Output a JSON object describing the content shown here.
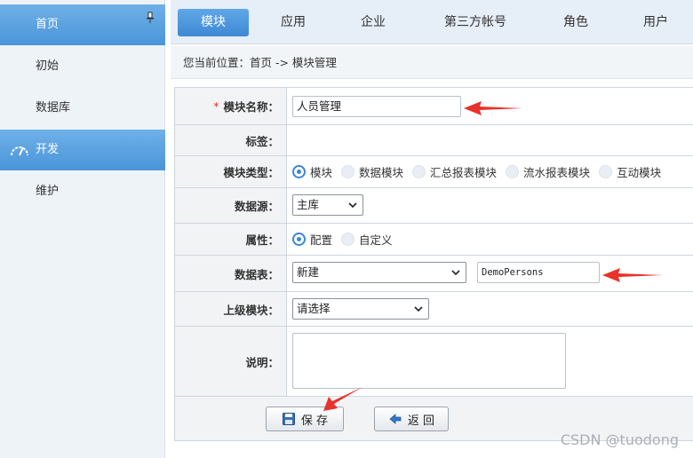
{
  "sidebar": {
    "items": [
      {
        "label": "首页",
        "active": true
      },
      {
        "label": "初始",
        "active": false
      },
      {
        "label": "数据库",
        "active": false
      },
      {
        "label": "开发",
        "active": true,
        "icon": "speedometer-icon"
      },
      {
        "label": "维护",
        "active": false
      }
    ],
    "pin_icon": "pin-icon"
  },
  "tabs": [
    {
      "label": "模块",
      "active": true
    },
    {
      "label": "应用",
      "active": false
    },
    {
      "label": "企业",
      "active": false
    },
    {
      "label": "第三方帐号",
      "active": false
    },
    {
      "label": "角色",
      "active": false
    },
    {
      "label": "用户",
      "active": false
    }
  ],
  "breadcrumb": "您当前位置：首页 -> 模块管理",
  "form": {
    "required_mark": "*",
    "module_name": {
      "label": "模块名称：",
      "value": "人员管理"
    },
    "tags": {
      "label": "标签："
    },
    "module_type": {
      "label": "模块类型：",
      "options": [
        "模块",
        "数据模块",
        "汇总报表模块",
        "流水报表模块",
        "互动模块"
      ],
      "selected": "模块"
    },
    "data_source": {
      "label": "数据源：",
      "value": "主库"
    },
    "attribute": {
      "label": "属性：",
      "options": [
        "配置",
        "自定义"
      ],
      "selected": "配置"
    },
    "data_table": {
      "label": "数据表：",
      "select_value": "新建",
      "input_value": "DemoPersons"
    },
    "parent_module": {
      "label": "上级模块：",
      "value": "请选择"
    },
    "description": {
      "label": "说明：",
      "value": ""
    }
  },
  "buttons": {
    "save": "保 存",
    "back": "返 回"
  },
  "watermark": "CSDN @tuodong",
  "colors": {
    "accent": "#3b86d6",
    "annotation_arrow": "#e8322b",
    "required": "#d9322a"
  }
}
